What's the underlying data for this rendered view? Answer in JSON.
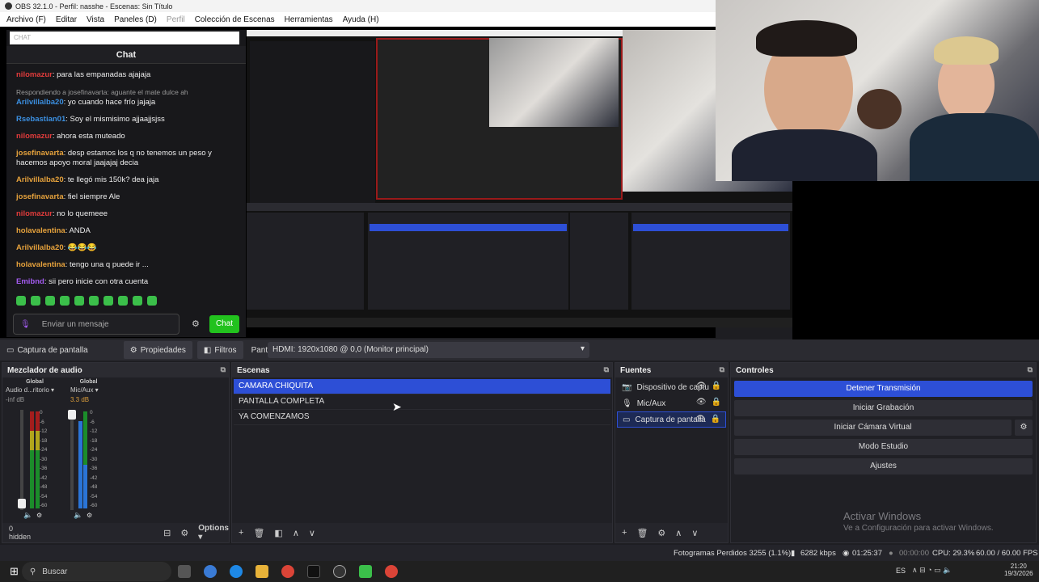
{
  "window": {
    "title": "OBS 32.1.0 - Perfil: nasshe - Escenas: Sin Título"
  },
  "menu": [
    "Archivo (F)",
    "Editar",
    "Vista",
    "Paneles (D)",
    "Perfil",
    "Colección de Escenas",
    "Herramientas",
    "Ayuda (H)"
  ],
  "chat": {
    "search_placeholder": "CHAT",
    "header": "Chat",
    "messages": [
      {
        "user": "nilomazur",
        "color": "#e03b3b",
        "text": ": para las empanadas ajajaja"
      },
      {
        "reply": "Respondiendo a josefinavarta: aguante el mate dulce ah",
        "user": "Arilvillalba20",
        "color": "#3b8fe0",
        "text": ": yo cuando hace frío jajaja"
      },
      {
        "user": "Rsebastian01",
        "color": "#3b8fe0",
        "text": ": Soy el mismisimo ajjaajjsjss"
      },
      {
        "user": "nilomazur",
        "color": "#e03b3b",
        "text": ": ahora esta muteado"
      },
      {
        "user": "josefinavarta",
        "color": "#e6a23c",
        "text": ": desp estamos los q no tenemos un peso y hacemos apoyo moral jaajajaj decia"
      },
      {
        "user": "Arilvillalba20",
        "color": "#e6a23c",
        "text": ": te llegó mis 150k? dea jaja"
      },
      {
        "user": "josefinavarta",
        "color": "#e6a23c",
        "text": ": fiel siempre Ale"
      },
      {
        "user": "nilomazur",
        "color": "#e03b3b",
        "text": ": no lo quemeee"
      },
      {
        "user": "holavalentina",
        "color": "#e6a23c",
        "text": ": ANDA"
      },
      {
        "user": "Arilvillalba20",
        "color": "#e6a23c",
        "text": ": 😂😂😂"
      },
      {
        "user": "holavalentina",
        "color": "#e6a23c",
        "text": ": tengo una q puede ir ..."
      },
      {
        "user": "Emibnd",
        "color": "#a35bf0",
        "text": ": sii pero inicie con otra cuenta"
      }
    ],
    "input_placeholder": "Enviar un mensaje",
    "send_label": "Chat"
  },
  "source_bar": {
    "current_source": "Captura de pantalla",
    "properties": "Propiedades",
    "filters": "Filtros",
    "screen_label": "Pantalla",
    "screen_value": "HDMI: 1920x1080 @ 0,0 (Monitor principal)"
  },
  "mixer": {
    "title": "Mezclador de audio",
    "channels": [
      {
        "header": "Global",
        "name": "Audio d...ritorio",
        "db": "-inf dB"
      },
      {
        "header": "Global",
        "name": "Mic/Aux",
        "db": "3.3 dB"
      }
    ],
    "ticks": [
      "0",
      "-6",
      "-12",
      "-18",
      "-24",
      "-30",
      "-36",
      "-42",
      "-48",
      "-54",
      "-60"
    ],
    "hidden": "0 hidden",
    "options": "Options"
  },
  "scenes": {
    "title": "Escenas",
    "items": [
      "CAMARA CHIQUITA",
      "PANTALLA COMPLETA",
      "YA COMENZAMOS"
    ],
    "selected_index": 0
  },
  "sources": {
    "title": "Fuentes",
    "items": [
      {
        "name": "Dispositivo de captu",
        "icon": "camera-icon"
      },
      {
        "name": "Mic/Aux",
        "icon": "mic-icon"
      },
      {
        "name": "Captura de pantalla",
        "icon": "monitor-icon"
      }
    ],
    "selected_index": 2
  },
  "controls": {
    "title": "Controles",
    "buttons": [
      "Detener Transmisión",
      "Iniciar Grabación",
      "Iniciar Cámara Virtual",
      "Modo Estudio",
      "Ajustes"
    ]
  },
  "watermark": {
    "title": "Activar Windows",
    "subtitle": "Ve a Configuración para activar Windows."
  },
  "status": {
    "dropped": "Fotogramas Perdidos 3255 (1.1%)",
    "bitrate": "6282 kbps",
    "stream_time": "01:25:37",
    "rec_time": "00:00:00",
    "cpu": "CPU: 29.3%",
    "fps": "60.00 / 60.00 FPS"
  },
  "taskbar": {
    "search": "Buscar",
    "lang": "ES",
    "time": "21:20",
    "date": "19/3/2026"
  }
}
